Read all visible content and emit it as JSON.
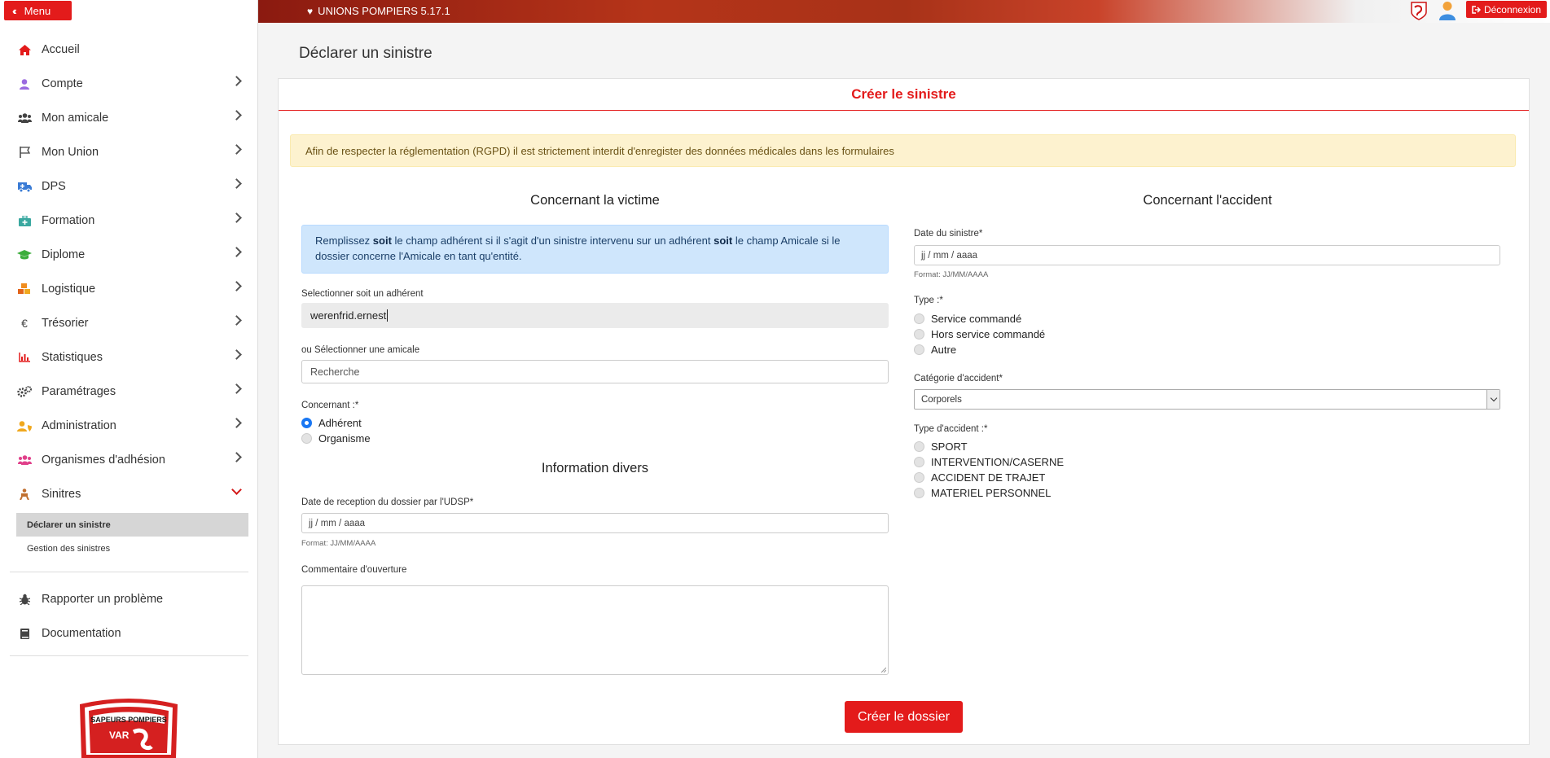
{
  "sidebar": {
    "menu_label": "Menu",
    "items": [
      {
        "label": "Accueil",
        "icon": "home-icon",
        "color": "#e31b1b"
      },
      {
        "label": "Compte",
        "icon": "user-icon",
        "color": "#9b6be0"
      },
      {
        "label": "Mon amicale",
        "icon": "users-icon",
        "color": "#444444"
      },
      {
        "label": "Mon Union",
        "icon": "flag-icon",
        "color": "#444444"
      },
      {
        "label": "DPS",
        "icon": "ambulance-icon",
        "color": "#3a7bd5"
      },
      {
        "label": "Formation",
        "icon": "medkit-icon",
        "color": "#3aa8a0"
      },
      {
        "label": "Diplome",
        "icon": "graduation-cap-icon",
        "color": "#3cae3c"
      },
      {
        "label": "Logistique",
        "icon": "cubes-icon",
        "color": "#f08c1e"
      },
      {
        "label": "Trésorier",
        "icon": "euro-icon",
        "color": "#444444"
      },
      {
        "label": "Statistiques",
        "icon": "bar-chart-icon",
        "color": "#e31b1b"
      },
      {
        "label": "Paramétrages",
        "icon": "cogs-icon",
        "color": "#444444"
      },
      {
        "label": "Administration",
        "icon": "user-shield-icon",
        "color": "#f0a81e"
      },
      {
        "label": "Organismes d'adhésion",
        "icon": "users-group-icon",
        "color": "#e0408a"
      },
      {
        "label": "Sinitres",
        "icon": "person-injured-icon",
        "color": "#c07030"
      }
    ],
    "sub_items": [
      {
        "label": "Déclarer un sinistre"
      },
      {
        "label": "Gestion des sinistres"
      }
    ],
    "footer_items": [
      {
        "label": "Rapporter un problème",
        "icon": "bug-icon"
      },
      {
        "label": "Documentation",
        "icon": "book-icon"
      }
    ],
    "logo_text": "SAPEURS POMPIERS VAR"
  },
  "topbar": {
    "brand": "UNIONS POMPIERS 5.17.1",
    "logout_label": "Déconnexion"
  },
  "page": {
    "title": "Déclarer un sinistre"
  },
  "card": {
    "header": "Créer le sinistre",
    "rgpd_warning": "Afin de respecter la réglementation (RGPD) il est strictement interdit d'enregister des données médicales dans les formulaires",
    "victim_title": "Concernant la victime",
    "accident_title": "Concernant l'accident",
    "info_pre": "Remplissez ",
    "info_soit1": "soit",
    "info_mid": " le champ adhérent si il s'agit d'un sinistre intervenu sur un adhérent ",
    "info_soit2": "soit",
    "info_post": " le champ Amicale si le dossier concerne l'Amicale en tant qu'entité.",
    "adherent_label": "Selectionner soit un adhérent",
    "adherent_value": "werenfrid.ernest",
    "amicale_label": "ou Sélectionner une amicale",
    "amicale_placeholder": "Recherche",
    "concernant_label": "Concernant :*",
    "concernant_options": [
      "Adhérent",
      "Organisme"
    ],
    "concernant_selected": "Adhérent",
    "info_divers_title": "Information divers",
    "reception_label": "Date de reception du dossier par l'UDSP*",
    "date_placeholder": "jj / mm / aaaa",
    "date_format_hint": "Format: JJ/MM/AAAA",
    "commentaire_label": "Commentaire d'ouverture",
    "date_sinistre_label": "Date du sinistre*",
    "type_label": "Type :*",
    "type_options": [
      "Service commandé",
      "Hors service commandé",
      "Autre"
    ],
    "categorie_label": "Catégorie d'accident*",
    "categorie_value": "Corporels",
    "type_accident_label": "Type d'accident :*",
    "type_accident_options": [
      "SPORT",
      "INTERVENTION/CASERNE",
      "ACCIDENT DE TRAJET",
      "MATERIEL PERSONNEL"
    ],
    "submit_label": "Créer le dossier"
  },
  "colors": {
    "accent": "#e31b1b",
    "warning_bg": "#fdf2cf",
    "info_bg": "#cfe6fc"
  }
}
